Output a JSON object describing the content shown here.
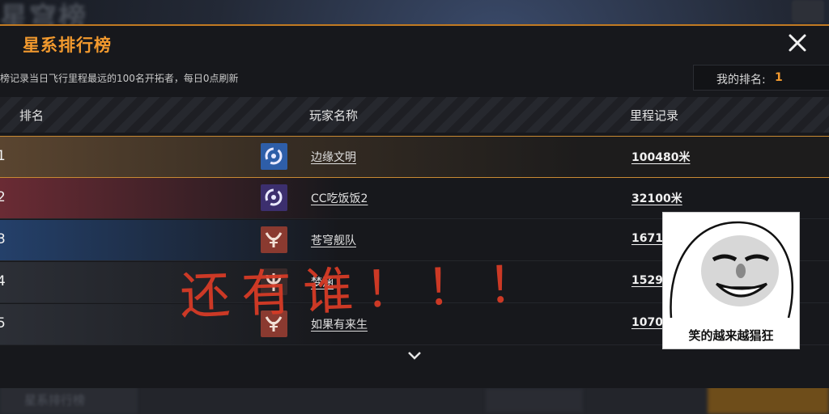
{
  "background": {
    "title": "星穹榜",
    "bottom_left_button": "星系排行榜"
  },
  "panel": {
    "title": "星系排行榜",
    "description": "榜记录当日飞行里程最远的100名开拓者，每日0点刷新",
    "my_rank_label": "我的排名:",
    "my_rank_value": "1",
    "columns": [
      "排名",
      "玩家名称",
      "里程记录"
    ],
    "rows": [
      {
        "rank": "1",
        "name": "边缘文明",
        "score": "100480米",
        "stripe": "#6b4a22",
        "avatar_bg": "#2e5ea8",
        "avatar_icon": "swirl-emblem-icon"
      },
      {
        "rank": "2",
        "name": "CC吃饭饭2",
        "score": "32100米",
        "stripe": "#6a2b34",
        "avatar_bg": "#3c2f6e",
        "avatar_icon": "swirl-emblem-icon"
      },
      {
        "rank": "3",
        "name": "苍穹舰队",
        "score": "16710",
        "stripe": "#24406a",
        "avatar_bg": "#8a3a30",
        "avatar_icon": "horns-emblem-icon"
      },
      {
        "rank": "4",
        "name": "梦涵",
        "score": "15290",
        "stripe": "#2c2f36",
        "avatar_bg": "#3a2a2a",
        "avatar_icon": "trident-emblem-icon"
      },
      {
        "rank": "5",
        "name": "如果有来生",
        "score": "10700",
        "stripe": "#2c2f36",
        "avatar_bg": "#8a3a30",
        "avatar_icon": "horns-emblem-icon"
      }
    ]
  },
  "overlay": {
    "handwriting": "还有谁！！！",
    "meme_caption": "笑的越来越猖狂"
  },
  "colors": {
    "accent": "#f39a2e",
    "handwriting": "#d63b26"
  }
}
